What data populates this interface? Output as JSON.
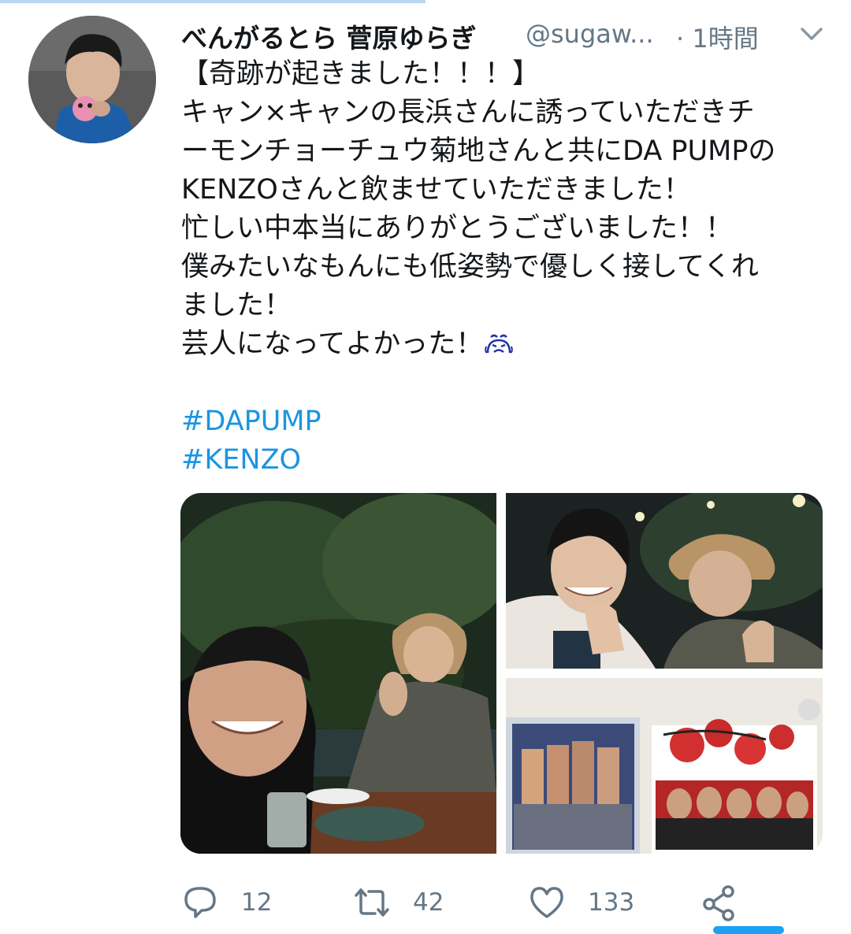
{
  "tweet": {
    "author_name": "べんがるとら 菅原ゆらぎ",
    "handle": "@sugaw...",
    "time": "· 1時間",
    "lines": [
      "【奇跡が起きました！！！】",
      "キャン×キャンの長浜さんに誘っていただきチ",
      "ーモンチョーチュウ菊地さんと共にDA PUMPの",
      "KENZOさんと飲ませていただきました！",
      "忙しい中本当にありがとうございました！！",
      "僕みたいなもんにも低姿勢で優しく接してくれ",
      "ました！",
      "芸人になってよかった！"
    ],
    "hashtags": [
      "#DAPUMP",
      "#KENZO"
    ],
    "media_count": 3
  },
  "actions": {
    "reply_count": "12",
    "retweet_count": "42",
    "like_count": "133"
  },
  "icons": {
    "more": "chevron-down-icon",
    "reply": "reply-icon",
    "retweet": "retweet-icon",
    "like": "heart-icon",
    "share": "share-icon",
    "emoji": "crying-face-icon"
  },
  "colors": {
    "text": "#14171a",
    "secondary": "#657786",
    "link": "#1b95e0"
  }
}
